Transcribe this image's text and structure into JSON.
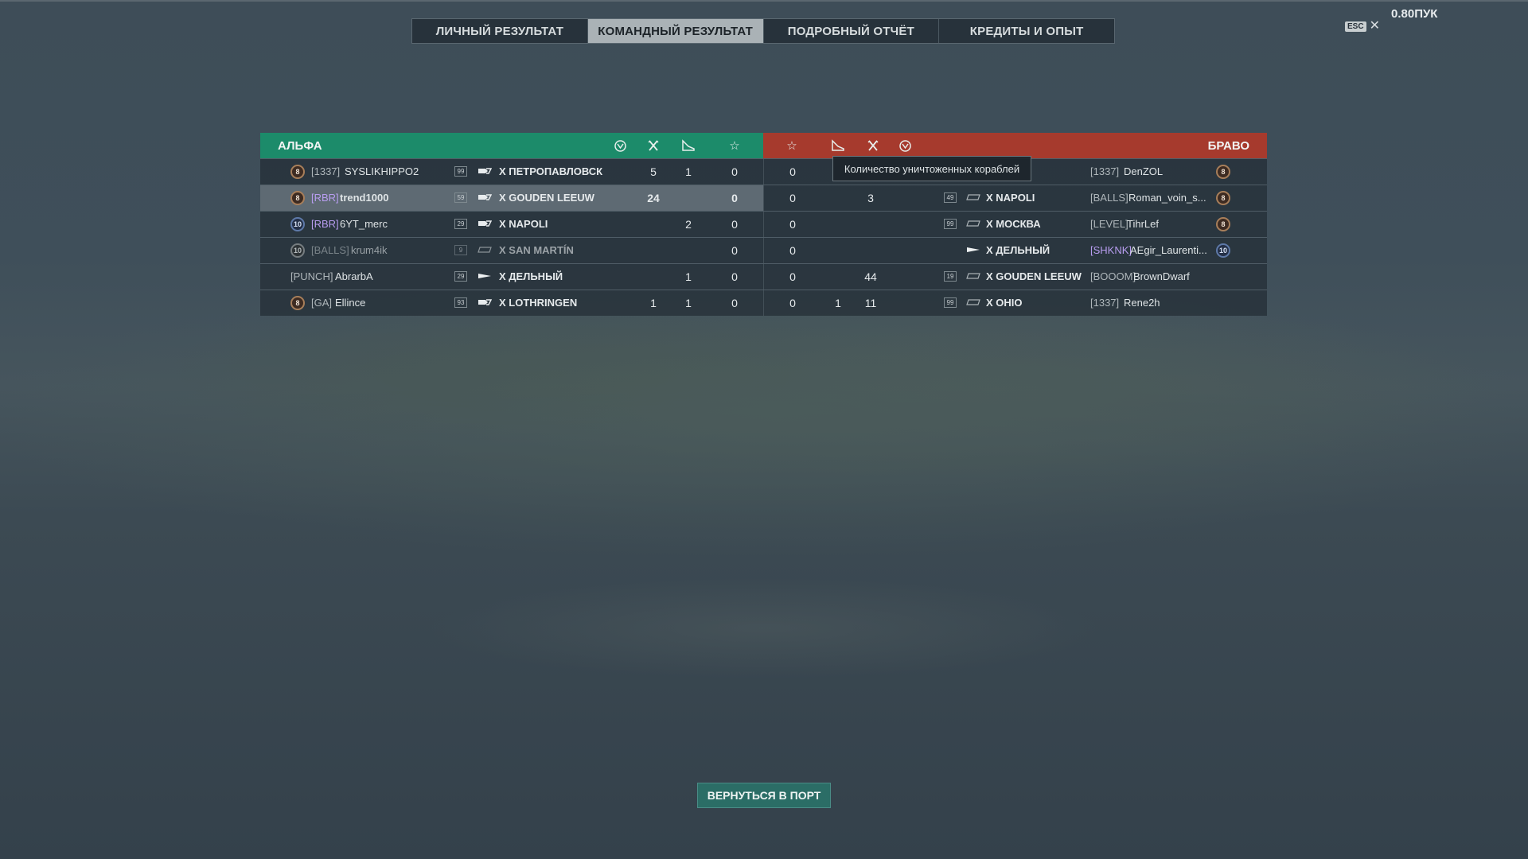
{
  "tabs": [
    "ЛИЧНЫЙ РЕЗУЛЬТАТ",
    "КОМАНДНЫЙ РЕЗУЛЬТАТ",
    "ПОДРОБНЫЙ ОТЧЁТ",
    "КРЕДИТЫ И ОПЫТ"
  ],
  "active_tab": "КОМАНДНЫЙ РЕЗУЛЬТАТ",
  "esc_label": "ESC",
  "top_right_text": "0.80ПУК",
  "teams": {
    "alpha": "АЛЬФА",
    "bravo": "БРАВО"
  },
  "header_icons": [
    "xp-icon",
    "kills-icon",
    "planes-icon",
    "star-icon"
  ],
  "tooltip": "Количество уничтоженных кораблей",
  "colors": {
    "alpha_header": "#1c8b6a",
    "bravo_header": "#a63a2d",
    "clan_highlight": "#b89df0"
  },
  "alpha_rows": [
    {
      "rank": "8",
      "clan": "[1337]",
      "name": "SYSLIKHIPPO2",
      "level": "99",
      "ship": "X  ПЕТРОПАВЛОВСК",
      "kills": "5",
      "planes": "1",
      "star": "0"
    },
    {
      "rank": "8",
      "clan": "[RBR]",
      "name": "trend1000",
      "level": "59",
      "ship": "X  GOUDEN LEEUW",
      "kills": "24",
      "planes": "",
      "star": "0"
    },
    {
      "rank": "10",
      "clan": "[RBR]",
      "name": "6YT_merc",
      "level": "29",
      "ship": "X  NAPOLI",
      "kills": "",
      "planes": "2",
      "star": "0"
    },
    {
      "rank": "10",
      "clan": "[BALLS]",
      "name": "krum4ik",
      "level": "9",
      "ship": "X  SAN MARTÍN",
      "kills": "",
      "planes": "",
      "star": "0"
    },
    {
      "rank": "",
      "clan": "[PUNCH]",
      "name": "AbrarbA",
      "level": "29",
      "ship": "X  ДЕЛЬНЫЙ",
      "kills": "",
      "planes": "1",
      "star": "0"
    },
    {
      "rank": "8",
      "clan": "[GA]",
      "name": "Ellince",
      "level": "93",
      "ship": "X  LOTHRINGEN",
      "kills": "1",
      "planes": "1",
      "star": "0"
    }
  ],
  "bravo_rows": [
    {
      "star": "0",
      "planes": "",
      "kills": "",
      "level": "",
      "ship": "",
      "clan": "[1337]",
      "name": "DenZOL",
      "rank": "8"
    },
    {
      "star": "0",
      "planes": "",
      "kills": "3",
      "level": "49",
      "ship": "X  NAPOLI",
      "clan": "[BALLS]",
      "name": "Roman_voin_s...",
      "rank": "8"
    },
    {
      "star": "0",
      "planes": "",
      "kills": "",
      "level": "99",
      "ship": "X  МОСКВА",
      "clan": "[LEVEL]",
      "name": "TihrLef",
      "rank": "8"
    },
    {
      "star": "0",
      "planes": "",
      "kills": "",
      "level": "",
      "ship": "X  ДЕЛЬНЫЙ",
      "clan": "[SHKNK]",
      "name": "AEgir_Laurenti...",
      "rank": "10"
    },
    {
      "star": "0",
      "planes": "",
      "kills": "44",
      "level": "19",
      "ship": "X  GOUDEN LEEUW",
      "clan": "[BOOOM]",
      "name": "BrownDwarf",
      "rank": ""
    },
    {
      "star": "0",
      "planes": "1",
      "kills": "11",
      "level": "99",
      "ship": "X  OHIO",
      "clan": "[1337]",
      "name": "Rene2h",
      "rank": ""
    }
  ],
  "return_button": "ВЕРНУТЬСЯ В ПОРТ"
}
